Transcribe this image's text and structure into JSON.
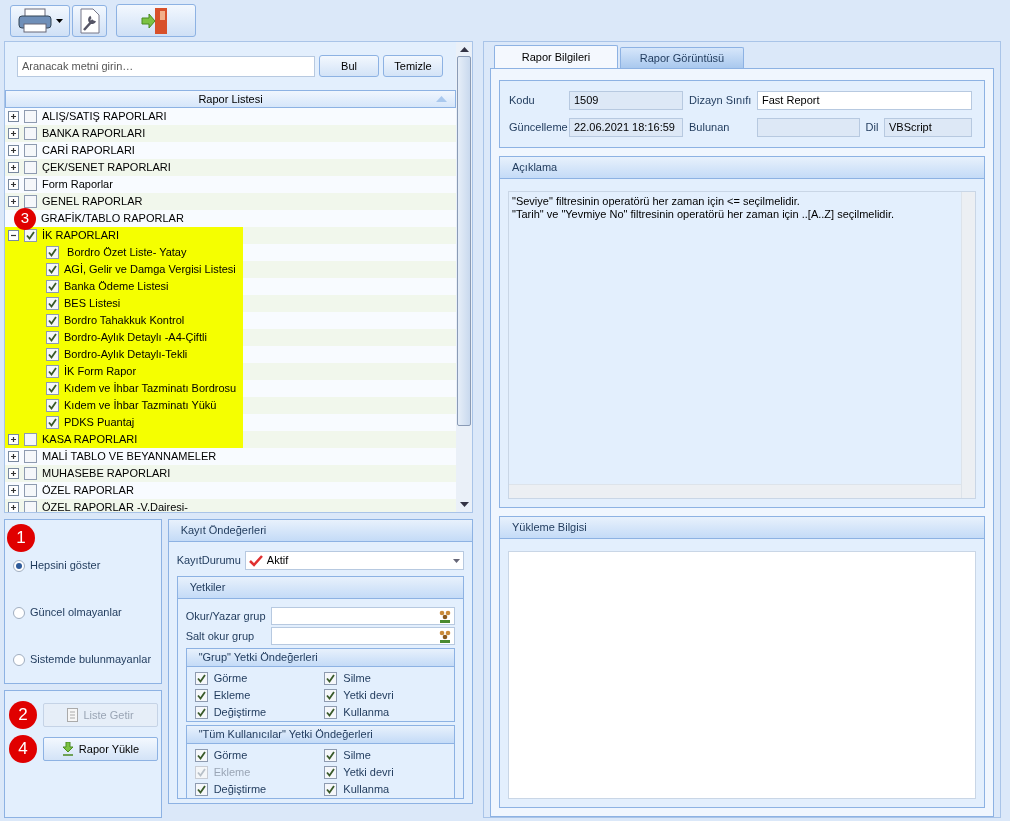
{
  "search": {
    "placeholder": "Aranacak metni girin…",
    "buttons": [
      "Bul",
      "Temizle"
    ]
  },
  "tree": {
    "header": "Rapor Listesi",
    "items": [
      {
        "label": "ALIŞ/SATIŞ RAPORLARI",
        "checked": false,
        "expanded": false,
        "highlighted": false
      },
      {
        "label": "BANKA RAPORLARI",
        "checked": false,
        "expanded": false,
        "highlighted": false
      },
      {
        "label": "CARİ RAPORLARI",
        "checked": false,
        "expanded": false,
        "highlighted": false
      },
      {
        "label": "ÇEK/SENET RAPORLARI",
        "checked": false,
        "expanded": false,
        "highlighted": false
      },
      {
        "label": "Form Raporlar",
        "checked": false,
        "expanded": false,
        "highlighted": false
      },
      {
        "label": "GENEL RAPORLAR",
        "checked": false,
        "expanded": false,
        "highlighted": false
      },
      {
        "label": "GRAFİK/TABLO RAPORLAR",
        "highlighted": false,
        "badge": "3"
      },
      {
        "label": "İK RAPORLARI",
        "checked": true,
        "expanded": true,
        "highlighted": true,
        "children": [
          {
            "label": " Bordro Özet Liste- Yatay",
            "checked": true,
            "highlighted": true
          },
          {
            "label": "AGİ, Gelir ve Damga Vergisi Listesi",
            "checked": true,
            "highlighted": true
          },
          {
            "label": "Banka Ödeme Listesi",
            "checked": true,
            "highlighted": true
          },
          {
            "label": "BES Listesi",
            "checked": true,
            "highlighted": true
          },
          {
            "label": "Bordro Tahakkuk Kontrol",
            "checked": true,
            "highlighted": true
          },
          {
            "label": "Bordro-Aylık Detaylı -A4-Çiftli",
            "checked": true,
            "highlighted": true
          },
          {
            "label": "Bordro-Aylık Detaylı-Tekli",
            "checked": true,
            "highlighted": true
          },
          {
            "label": "İK Form Rapor",
            "checked": true,
            "highlighted": true
          },
          {
            "label": "Kıdem ve İhbar Tazminatı Bordrosu",
            "checked": true,
            "highlighted": true
          },
          {
            "label": "Kıdem ve İhbar Tazminatı Yükü",
            "checked": true,
            "highlighted": true
          },
          {
            "label": "PDKS Puantaj",
            "checked": true,
            "highlighted": true
          }
        ]
      },
      {
        "label": "KASA RAPORLARI",
        "checked": false,
        "expanded": false,
        "highlighted": true
      },
      {
        "label": "MALİ TABLO VE BEYANNAMELER",
        "checked": false,
        "expanded": false,
        "highlighted": false
      },
      {
        "label": "MUHASEBE RAPORLARI",
        "checked": false,
        "expanded": false,
        "highlighted": false
      },
      {
        "label": "ÖZEL RAPORLAR",
        "checked": false,
        "expanded": false,
        "highlighted": false
      },
      {
        "label": "ÖZEL RAPORLAR -V.Dairesi-",
        "checked": false,
        "expanded": false,
        "highlighted": false
      }
    ]
  },
  "filter": {
    "badge": "1",
    "options": [
      {
        "label": "Hepsini göster",
        "selected": true
      },
      {
        "label": "Güncel olmayanlar",
        "selected": false
      },
      {
        "label": "Sistemde bulunmayanlar",
        "selected": false
      }
    ]
  },
  "actions": [
    {
      "label": "Liste Getir",
      "kind": "list",
      "disabled": true,
      "badge": "2"
    },
    {
      "label": "Rapor Yükle",
      "kind": "load",
      "disabled": false,
      "badge": "4"
    }
  ],
  "defaults": {
    "title": "Kayıt Öndeğerleri",
    "status_label": "KayıtDurumu",
    "status_value": "Aktif",
    "permissions": {
      "title": "Yetkiler",
      "fields": [
        {
          "label": "Okur/Yazar grup"
        },
        {
          "label": "Salt okur grup"
        }
      ],
      "groups": [
        {
          "title": "\"Grup\" Yetki Öndeğerleri",
          "checks": [
            {
              "label": "Görme",
              "checked": true,
              "disabled": false
            },
            {
              "label": "Silme",
              "checked": true,
              "disabled": false
            },
            {
              "label": "Ekleme",
              "checked": true,
              "disabled": false
            },
            {
              "label": "Yetki devri",
              "checked": true,
              "disabled": false
            },
            {
              "label": "Değiştirme",
              "checked": true,
              "disabled": false
            },
            {
              "label": "Kullanma",
              "checked": true,
              "disabled": false
            }
          ]
        },
        {
          "title": "\"Tüm Kullanıcılar\" Yetki Öndeğerleri",
          "checks": [
            {
              "label": "Görme",
              "checked": true,
              "disabled": false
            },
            {
              "label": "Silme",
              "checked": true,
              "disabled": false
            },
            {
              "label": "Ekleme",
              "checked": true,
              "disabled": true
            },
            {
              "label": "Yetki devri",
              "checked": true,
              "disabled": false
            },
            {
              "label": "Değiştirme",
              "checked": true,
              "disabled": false
            },
            {
              "label": "Kullanma",
              "checked": true,
              "disabled": false
            }
          ]
        }
      ]
    }
  },
  "tabs": [
    {
      "label": "Rapor Bilgileri",
      "selected": true
    },
    {
      "label": "Rapor Görüntüsü",
      "selected": false
    }
  ],
  "info": {
    "code_label": "Kodu",
    "code": "1509",
    "design_label": "Dizayn Sınıfı",
    "design": "Fast Report",
    "updated_label": "Güncelleme",
    "updated": "22.06.2021 18:16:59",
    "found_label": "Bulunan",
    "lang_label": "Dil",
    "lang": "VBScript"
  },
  "description": {
    "title": "Açıklama",
    "lines": [
      "\"Seviye\" filtresinin operatörü her zaman için <= seçilmelidir.",
      "\"Tarih\" ve \"Yevmiye No\" filtresinin operatörü her zaman için ..[A..Z] seçilmelidir."
    ]
  },
  "upload": {
    "title": "Yükleme Bilgisi"
  }
}
